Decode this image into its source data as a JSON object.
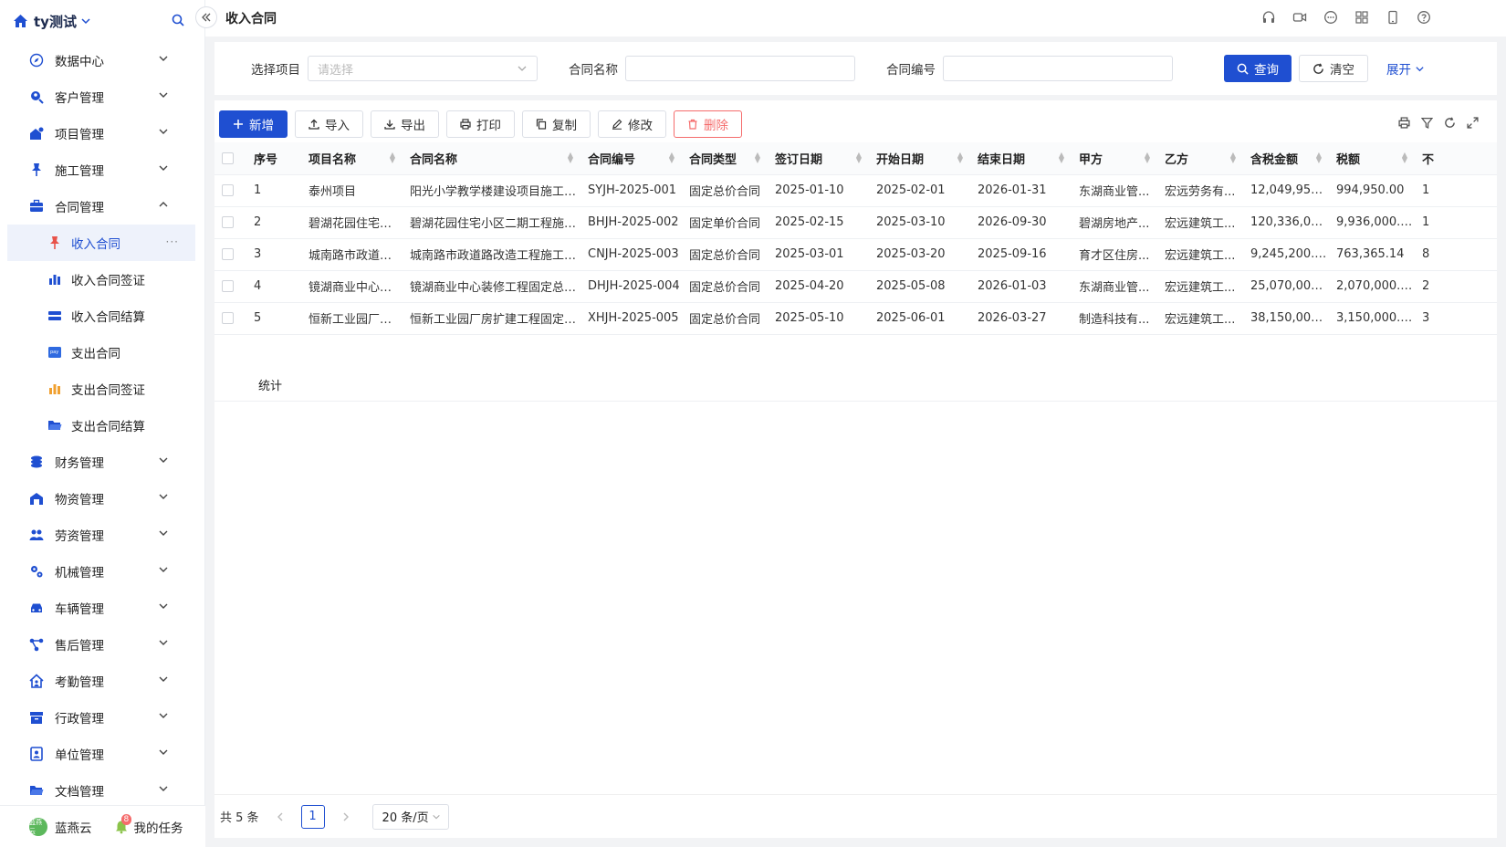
{
  "app": {
    "title": "ty测试"
  },
  "page": {
    "title": "收入合同"
  },
  "sidebar": {
    "items": [
      {
        "label": "数据中心",
        "name": "data-center"
      },
      {
        "label": "客户管理",
        "name": "customers"
      },
      {
        "label": "项目管理",
        "name": "projects"
      },
      {
        "label": "施工管理",
        "name": "construction"
      },
      {
        "label": "合同管理",
        "name": "contracts"
      }
    ],
    "sub_items": [
      {
        "label": "收入合同",
        "name": "income-contract"
      },
      {
        "label": "收入合同签证",
        "name": "income-visa"
      },
      {
        "label": "收入合同结算",
        "name": "income-settlement"
      },
      {
        "label": "支出合同",
        "name": "expense-contract"
      },
      {
        "label": "支出合同签证",
        "name": "expense-visa"
      },
      {
        "label": "支出合同结算",
        "name": "expense-settlement"
      }
    ],
    "items_after": [
      {
        "label": "财务管理",
        "name": "finance"
      },
      {
        "label": "物资管理",
        "name": "materials"
      },
      {
        "label": "劳资管理",
        "name": "labor"
      },
      {
        "label": "机械管理",
        "name": "machinery"
      },
      {
        "label": "车辆管理",
        "name": "vehicles"
      },
      {
        "label": "售后管理",
        "name": "after-sales"
      },
      {
        "label": "考勤管理",
        "name": "attendance"
      },
      {
        "label": "行政管理",
        "name": "admin"
      },
      {
        "label": "单位管理",
        "name": "units"
      },
      {
        "label": "文档管理",
        "name": "documents"
      }
    ],
    "user": {
      "avatar_text": "蓝燕云",
      "name": "蓝燕云"
    },
    "tasks": {
      "label": "我的任务",
      "badge": "8"
    }
  },
  "search": {
    "project_label": "选择项目",
    "project_placeholder": "请选择",
    "name_label": "合同名称",
    "code_label": "合同编号",
    "query_button": "查询",
    "clear_button": "清空",
    "expand_link": "展开"
  },
  "toolbar": {
    "add": "新增",
    "import": "导入",
    "export": "导出",
    "print": "打印",
    "copy": "复制",
    "edit": "修改",
    "delete": "删除"
  },
  "table": {
    "columns": [
      "序号",
      "项目名称",
      "合同名称",
      "合同编号",
      "合同类型",
      "签订日期",
      "开始日期",
      "结束日期",
      "甲方",
      "乙方",
      "含税金额",
      "税额",
      "不"
    ],
    "rows": [
      [
        "1",
        "泰州项目",
        "阳光小学教学楼建设项目施工总...",
        "SYJH-2025-001",
        "固定总价合同",
        "2025-01-10",
        "2025-02-01",
        "2026-01-31",
        "东湖商业管...",
        "宏远劳务有...",
        "12,049,950.00",
        "994,950.00",
        "1"
      ],
      [
        "2",
        "碧湖花园住宅小...",
        "碧湖花园住宅小区二期工程施工...",
        "BHJH-2025-002",
        "固定单价合同",
        "2025-02-15",
        "2025-03-10",
        "2026-09-30",
        "碧湖房地产...",
        "宏远建筑工...",
        "120,336,000.00",
        "9,936,000.00",
        "1"
      ],
      [
        "3",
        "城南路市政道路...",
        "城南路市政道路改造工程施工合同",
        "CNJH-2025-003",
        "固定总价合同",
        "2025-03-01",
        "2025-03-20",
        "2025-09-16",
        "育才区住房...",
        "宏远建筑工...",
        "9,245,200.00",
        "763,365.14",
        "8"
      ],
      [
        "4",
        "镜湖商业中心装...",
        "镜湖商业中心装修工程固定总价...",
        "DHJH-2025-004",
        "固定总价合同",
        "2025-04-20",
        "2025-05-08",
        "2026-01-03",
        "东湖商业管...",
        "宏远建筑工...",
        "25,070,000.00",
        "2,070,000.00",
        "2"
      ],
      [
        "5",
        "恒新工业园厂房...",
        "恒新工业园厂房扩建工程固定总...",
        "XHJH-2025-005",
        "固定总价合同",
        "2025-05-10",
        "2025-06-01",
        "2026-03-27",
        "制造科技有...",
        "宏远建筑工...",
        "38,150,000.00",
        "3,150,000.00",
        "3"
      ]
    ],
    "summary_label": "统计"
  },
  "pagination": {
    "total": "共 5 条",
    "current_page": "1",
    "page_size": "20 条/页"
  },
  "colors": {
    "primary": "#1f4fd1",
    "danger": "#f56c6c",
    "accent_orange": "#f0a030"
  }
}
